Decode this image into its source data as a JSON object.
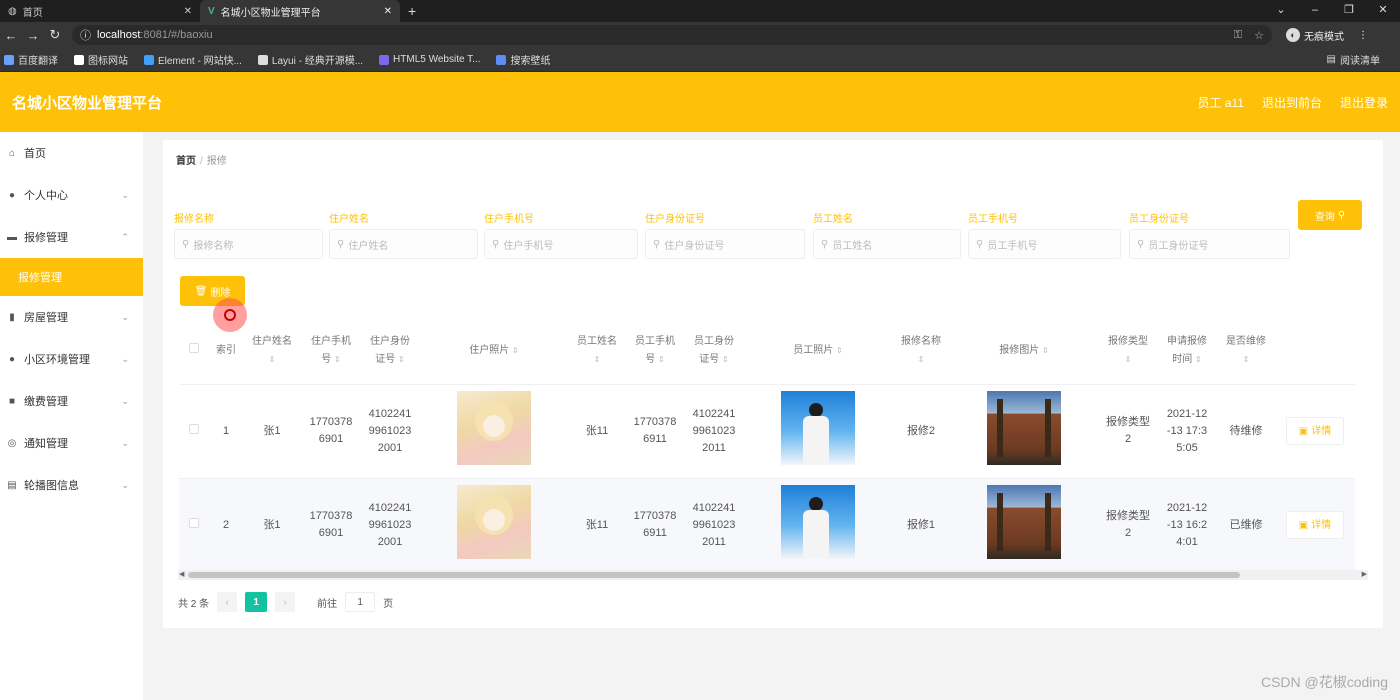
{
  "browser": {
    "tabs": [
      {
        "label": "首页"
      },
      {
        "label": "名城小区物业管理平台"
      }
    ],
    "url_host": "localhost",
    "url_path": ":8081/#/baoxiu",
    "profile_label": "无痕模式",
    "bookmarks": [
      "百度翻译",
      "图标网站",
      "Element - 网站快...",
      "Layui - 经典开源模...",
      "HTML5 Website T...",
      "搜索壁纸"
    ],
    "reading_list": "阅读清单"
  },
  "header": {
    "title": "名城小区物业管理平台",
    "user": "员工 a11",
    "back_front": "退出到前台",
    "logout": "退出登录"
  },
  "sidebar": {
    "items": [
      {
        "label": "首页"
      },
      {
        "label": "个人中心"
      },
      {
        "label": "报修管理"
      },
      {
        "label": "房屋管理"
      },
      {
        "label": "小区环境管理"
      },
      {
        "label": "缴费管理"
      },
      {
        "label": "通知管理"
      },
      {
        "label": "轮播图信息"
      }
    ],
    "active_sub": "报修管理"
  },
  "breadcrumb": {
    "home": "首页",
    "sep": "/",
    "current": "报修"
  },
  "filters": [
    {
      "label": "报修名称",
      "placeholder": "报修名称"
    },
    {
      "label": "住户姓名",
      "placeholder": "住户姓名"
    },
    {
      "label": "住户手机号",
      "placeholder": "住户手机号"
    },
    {
      "label": "住户身份证号",
      "placeholder": "住户身份证号"
    },
    {
      "label": "员工姓名",
      "placeholder": "员工姓名"
    },
    {
      "label": "员工手机号",
      "placeholder": "员工手机号"
    },
    {
      "label": "员工身份证号",
      "placeholder": "员工身份证号"
    }
  ],
  "buttons": {
    "query": "查询",
    "delete": "删除",
    "detail": "详情"
  },
  "table": {
    "headers": {
      "index": "索引",
      "owner_name": [
        "住户姓名"
      ],
      "owner_phone": [
        "住户手机",
        "号"
      ],
      "owner_id": [
        "住户身份",
        "证号"
      ],
      "owner_photo": "住户照片",
      "staff_name": "员工姓名",
      "staff_phone": [
        "员工手机",
        "号"
      ],
      "staff_id": [
        "员工身份",
        "证号"
      ],
      "staff_photo": "员工照片",
      "repair_name": "报修名称",
      "repair_photo": "报修图片",
      "repair_type": [
        "报修类型"
      ],
      "apply_time": [
        "申请报修",
        "时间"
      ],
      "is_repaired": [
        "是否维修"
      ]
    },
    "rows": [
      {
        "index": "1",
        "owner_name": "张1",
        "owner_phone": [
          "1770378",
          "6901"
        ],
        "owner_id": [
          "4102241",
          "9961023",
          "2001"
        ],
        "staff_name": "张11",
        "staff_phone": [
          "1770378",
          "6911"
        ],
        "staff_id": [
          "4102241",
          "9961023",
          "2011"
        ],
        "repair_name": "报修2",
        "repair_type": [
          "报修类型",
          "2"
        ],
        "apply_time": [
          "2021-12",
          "-13 17:3",
          "5:05"
        ],
        "is_repaired": "待维修"
      },
      {
        "index": "2",
        "owner_name": "张1",
        "owner_phone": [
          "1770378",
          "6901"
        ],
        "owner_id": [
          "4102241",
          "9961023",
          "2001"
        ],
        "staff_name": "张11",
        "staff_phone": [
          "1770378",
          "6911"
        ],
        "staff_id": [
          "4102241",
          "9961023",
          "2011"
        ],
        "repair_name": "报修1",
        "repair_type": [
          "报修类型",
          "2"
        ],
        "apply_time": [
          "2021-12",
          "-13 16:2",
          "4:01"
        ],
        "is_repaired": "已维修"
      }
    ]
  },
  "pagination": {
    "total": "共 2 条",
    "current": "1",
    "goto": "前往",
    "page_input": "1",
    "page_unit": "页"
  },
  "watermark": "CSDN @花椒coding",
  "colors": {
    "accent": "#ffc107",
    "pager_active": "#13c2a0"
  }
}
